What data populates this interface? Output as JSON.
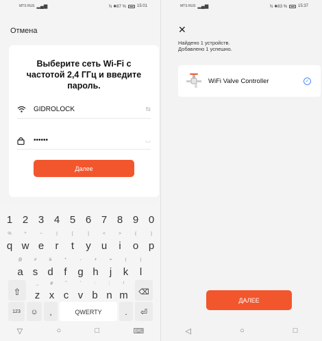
{
  "left": {
    "status": {
      "carrier": "MTS RUS",
      "right": "ℕ ✱87 %",
      "time": "15:01"
    },
    "cancel_label": "Отмена",
    "title": "Выберите сеть Wi-Fi с\nчастотой 2,4 ГГц и введите\nпароль.",
    "wifi_name": "GIDROLOCK",
    "password_mask": "••••••",
    "next_label": "Далее",
    "keyboard": {
      "numbers": [
        "1",
        "2",
        "3",
        "4",
        "5",
        "6",
        "7",
        "8",
        "9",
        "0"
      ],
      "row1": [
        {
          "s": "%",
          "m": "q"
        },
        {
          "s": "^",
          "m": "w"
        },
        {
          "s": "~",
          "m": "e"
        },
        {
          "s": "|",
          "m": "r"
        },
        {
          "s": "[",
          "m": "t"
        },
        {
          "s": "]",
          "m": "y"
        },
        {
          "s": "<",
          "m": "u"
        },
        {
          "s": ">",
          "m": "i"
        },
        {
          "s": "{",
          "m": "o"
        },
        {
          "s": "}",
          "m": "p"
        }
      ],
      "row2": [
        {
          "s": "@",
          "m": "a"
        },
        {
          "s": "#",
          "m": "s"
        },
        {
          "s": "&",
          "m": "d"
        },
        {
          "s": "*",
          "m": "f"
        },
        {
          "s": "-",
          "m": "g"
        },
        {
          "s": "+",
          "m": "h"
        },
        {
          "s": "=",
          "m": "j"
        },
        {
          "s": "(",
          "m": "k"
        },
        {
          "s": ")",
          "m": "l"
        }
      ],
      "row3": [
        {
          "s": "_",
          "m": "z"
        },
        {
          "s": "₽",
          "m": "x"
        },
        {
          "s": "\"",
          "m": "c"
        },
        {
          "s": "'",
          "m": "v"
        },
        {
          "s": ":",
          "m": "b"
        },
        {
          "s": ";",
          "m": "n"
        },
        {
          "s": "/",
          "m": "m"
        }
      ],
      "num_label": "123",
      "space_label": "QWERTY",
      "comma": ",",
      "dot": "."
    }
  },
  "right": {
    "status": {
      "carrier": "MTS RUS",
      "right": "ℕ ✱83 %",
      "time": "15:37"
    },
    "found_line1": "Найдено 1 устройств.",
    "found_line2": "Добавлено 1 успешно.",
    "device_name": "WiFi Valve Controller",
    "next_label": "ДАЛЕЕ"
  },
  "colors": {
    "accent": "#f2562d",
    "check": "#4a8cf6"
  }
}
